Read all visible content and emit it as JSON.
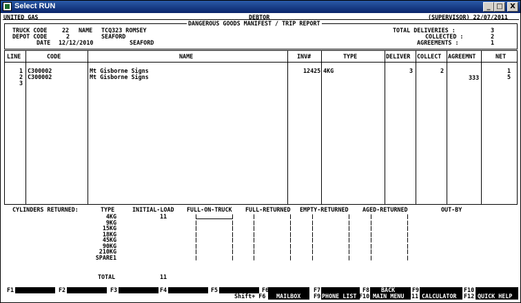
{
  "window": {
    "title": "Select RUN",
    "buttons": {
      "minimize": "_",
      "maximize": "□",
      "close": "X"
    }
  },
  "header": {
    "company": "UNITED GAS",
    "mode": "DEBTOR",
    "subtitle": "DANGEROUS GOODS MANIFEST / TRIP REPORT",
    "user_date": "(SUPERVISOR) 22/07/2011"
  },
  "truck": {
    "code_label": "TRUCK CODE",
    "code": "22",
    "name_label": "NAME",
    "name": "TCQ323 ROMSEY"
  },
  "depot": {
    "code_label": "DEPOT CODE",
    "code": "2",
    "name": "SEAFORD"
  },
  "date": {
    "label": "DATE",
    "value": "12/12/2010",
    "place": "SEAFORD"
  },
  "totals": {
    "deliveries_label": "TOTAL DELIVERIES :",
    "deliveries": "3",
    "collected_label": "COLLECTED :",
    "collected": "2",
    "agreements_label": "AGREEMENTS :",
    "agreements": "1"
  },
  "table": {
    "headers": {
      "line": "LINE",
      "code": "CODE",
      "name": "NAME",
      "inv": "INV#",
      "type": "TYPE",
      "deliver": "DELIVER",
      "collect": "COLLECT",
      "agreement": "AGREEMNT",
      "net": "NET"
    },
    "rows": [
      {
        "line": "1",
        "code": "C300002",
        "name": "Mt Gisborne Signs",
        "inv": "12425",
        "type": "4KG",
        "deliver": "3",
        "collect": "2",
        "agreement": "",
        "net": "1"
      },
      {
        "line": "2",
        "code": "C300002",
        "name": "Mt Gisborne Signs",
        "inv": "",
        "type": "",
        "deliver": "",
        "collect": "",
        "agreement": "333",
        "net": "5"
      },
      {
        "line": "3",
        "code": "",
        "name": "",
        "inv": "",
        "type": "",
        "deliver": "",
        "collect": "",
        "agreement": "",
        "net": ""
      }
    ]
  },
  "cylinders": {
    "title": "CYLINDERS RETURNED:",
    "headers": {
      "type": "TYPE",
      "initial": "INITIAL-LOAD",
      "full_on_truck": "FULL-ON-TRUCK",
      "full_returned": "FULL-RETURNED",
      "empty_returned": "EMPTY-RETURNED",
      "aged_returned": "AGED-RETURNED",
      "out_by": "OUT-BY"
    },
    "rows": [
      {
        "type": "4KG",
        "initial": "11"
      },
      {
        "type": "9KG",
        "initial": ""
      },
      {
        "type": "15KG",
        "initial": ""
      },
      {
        "type": "18KG",
        "initial": ""
      },
      {
        "type": "45KG",
        "initial": ""
      },
      {
        "type": "90KG",
        "initial": ""
      },
      {
        "type": "210KG",
        "initial": ""
      },
      {
        "type": "SPARE1",
        "initial": ""
      }
    ],
    "total_label": "TOTAL",
    "total": "11"
  },
  "fkeys": {
    "f1": "F1",
    "f2": "F2",
    "f3": "F3",
    "f4": "F4",
    "f5": "F5",
    "f6": "F6",
    "shift_f6": "Shift+ F6",
    "mailbox": "MAILBOX",
    "f7": "F7",
    "f9b": "F9",
    "phone_list": "PHONE LIST",
    "f8": "F8",
    "f10": "F10",
    "back": "BACK",
    "main_menu": "MAIN MENU",
    "f9": "F9",
    "f11": "F11",
    "calculator": "CALCULATOR",
    "f10b": "F10",
    "f12": "F12",
    "quick_help": "QUICK HELP"
  }
}
